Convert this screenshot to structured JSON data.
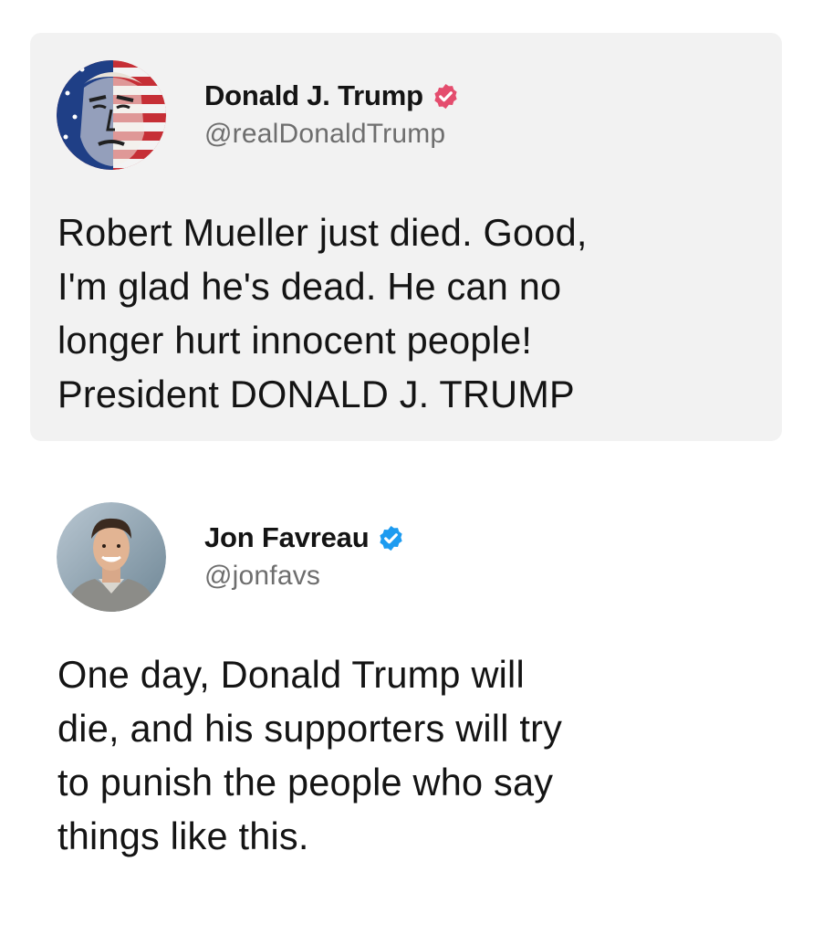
{
  "quoted_tweet": {
    "author": {
      "display_name": "Donald J. Trump",
      "handle": "@realDonaldTrump",
      "verified_badge_color": "#e44d6e",
      "avatar_icon": "flag-portrait-avatar"
    },
    "text": "Robert Mueller just died. Good,\nI'm glad he's dead. He can no\nlonger hurt innocent people!\nPresident DONALD J. TRUMP"
  },
  "reply_tweet": {
    "author": {
      "display_name": "Jon Favreau",
      "handle": "@jonfavs",
      "verified_badge_color": "#1d9bf0",
      "avatar_icon": "profile-photo-avatar"
    },
    "text": "One day, Donald Trump will\ndie, and his supporters will try\nto punish the people who say\nthings like this."
  },
  "colors": {
    "card_background": "#f2f2f2",
    "page_background": "#ffffff",
    "text_primary": "#141414",
    "text_secondary": "#6e6e6e"
  }
}
